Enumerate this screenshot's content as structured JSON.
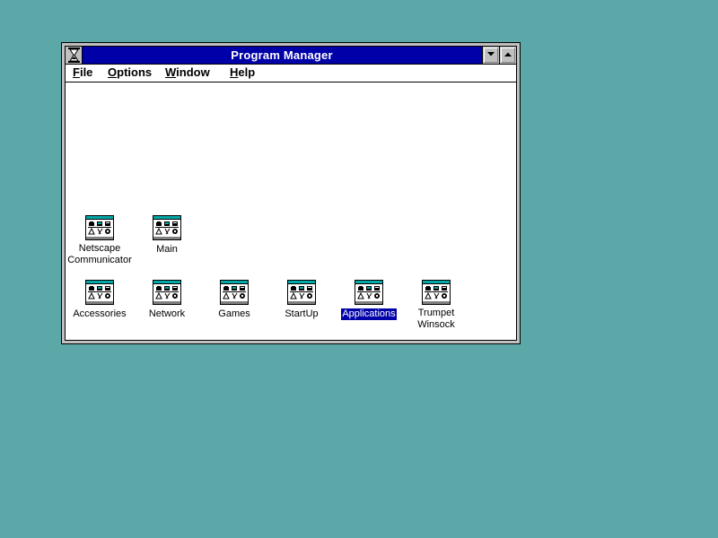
{
  "window": {
    "title": "Program Manager",
    "colors": {
      "titlebar": "#0000a8",
      "desktop": "#5ca8a8",
      "selection": "#0000a8"
    }
  },
  "menu": [
    {
      "access_key": "F",
      "rest": "ile"
    },
    {
      "access_key": "O",
      "rest": "ptions"
    },
    {
      "access_key": "W",
      "rest": "indow"
    },
    {
      "access_key": "H",
      "rest": "elp"
    }
  ],
  "groups": [
    {
      "label1": "Netscape",
      "label2": "Communicator",
      "icon": "program-group-icon"
    },
    {
      "label1": "Main",
      "label2": "",
      "icon": "program-group-icon"
    },
    {
      "label1": "Accessories",
      "label2": "",
      "icon": "program-group-icon"
    },
    {
      "label1": "Network",
      "label2": "",
      "icon": "program-group-icon"
    },
    {
      "label1": "Games",
      "label2": "",
      "icon": "program-group-icon"
    },
    {
      "label1": "StartUp",
      "label2": "",
      "icon": "program-group-icon"
    },
    {
      "label1": "Applications",
      "label2": "",
      "icon": "program-group-icon",
      "selected": true
    },
    {
      "label1": "Trumpet",
      "label2": "Winsock",
      "icon": "program-group-icon"
    }
  ],
  "icons": {
    "system_menu": "hourglass-icon",
    "minimize": "minimize-arrow-icon",
    "maximize": "maximize-arrow-icon"
  }
}
